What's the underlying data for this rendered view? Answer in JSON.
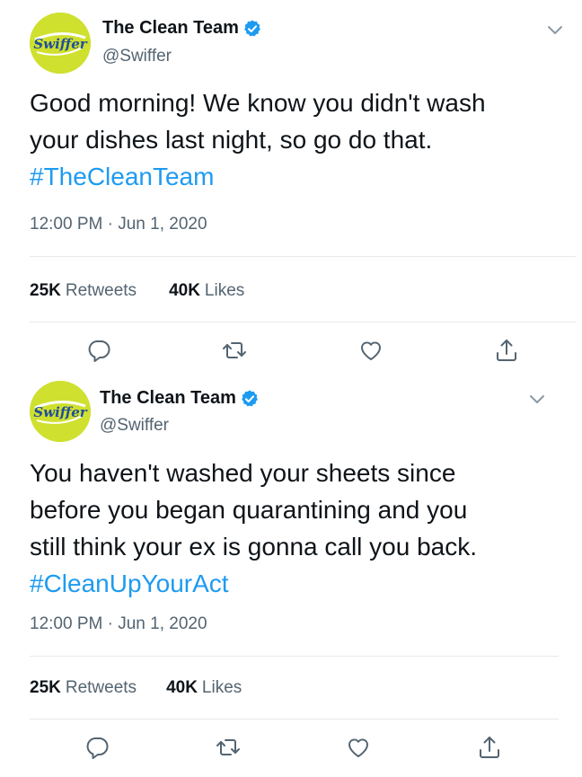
{
  "colors": {
    "accent": "#1d9bf0",
    "text_primary": "#0f1419",
    "text_secondary": "#536471",
    "divider": "#e6e9ea",
    "avatar_bg": "#cfe02f"
  },
  "tweets": [
    {
      "avatar": {
        "icon": "swiffer-logo",
        "logo_text": "Swiffer"
      },
      "display_name": "The Clean Team",
      "verified_icon": "verified-badge-icon",
      "handle": "@Swiffer",
      "menu_icon": "chevron-down-icon",
      "text_lines": [
        "Good morning! We know you didn't wash",
        "your dishes last night, so go do that."
      ],
      "hashtag": "#TheCleanTeam",
      "timestamp": "12:00 PM · Jun 1, 2020",
      "retweets_count": "25K",
      "retweets_label": "Retweets",
      "likes_count": "40K",
      "likes_label": "Likes",
      "actions": [
        "reply-icon",
        "retweet-icon",
        "like-icon",
        "share-icon"
      ]
    },
    {
      "avatar": {
        "icon": "swiffer-logo",
        "logo_text": "Swiffer"
      },
      "display_name": "The Clean Team",
      "verified_icon": "verified-badge-icon",
      "handle": "@Swiffer",
      "menu_icon": "chevron-down-icon",
      "text_lines": [
        "You haven't washed your sheets since",
        "before you began quarantining and you",
        "still think your ex is gonna call you back."
      ],
      "hashtag": "#CleanUpYourAct",
      "timestamp": "12:00 PM · Jun 1, 2020",
      "retweets_count": "25K",
      "retweets_label": "Retweets",
      "likes_count": "40K",
      "likes_label": "Likes",
      "actions": [
        "reply-icon",
        "retweet-icon",
        "like-icon",
        "share-icon"
      ]
    }
  ]
}
